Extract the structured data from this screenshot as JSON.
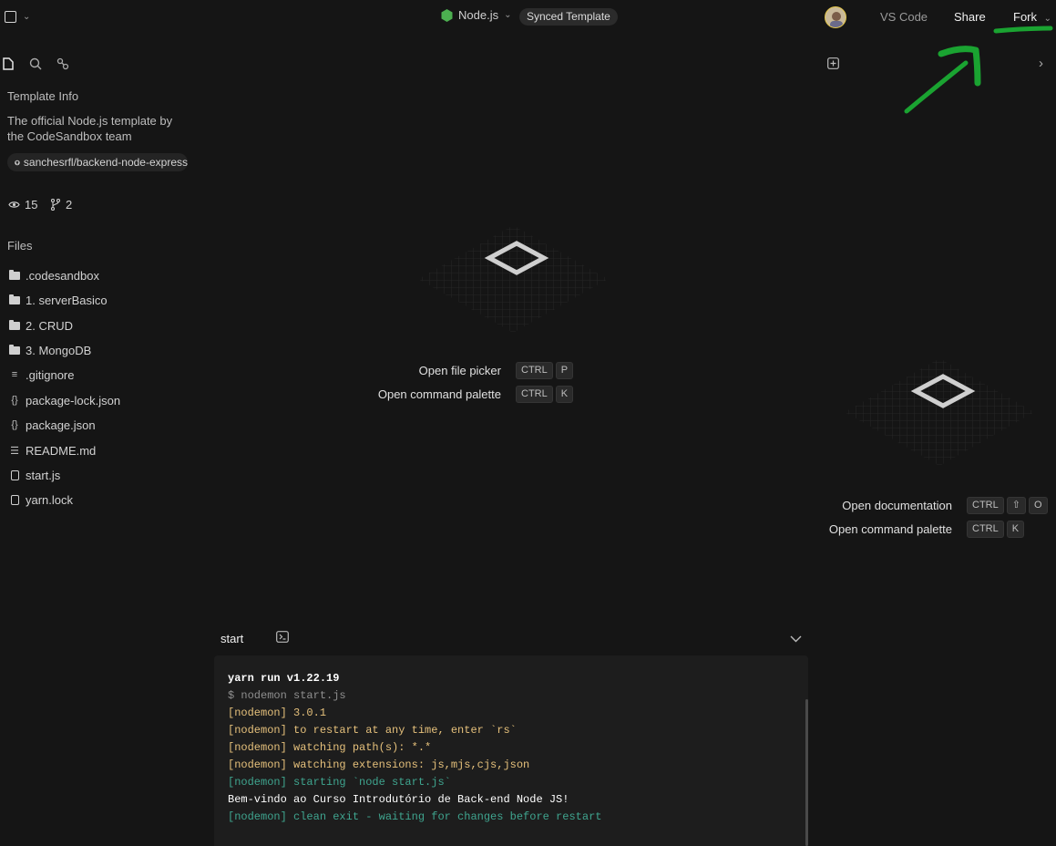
{
  "topbar": {
    "template_name": "Node.js",
    "template_badge": "Synced Template",
    "vscode_label": "VS Code",
    "share_label": "Share",
    "fork_label": "Fork"
  },
  "sidebar": {
    "section_title": "Template Info",
    "description": "The official Node.js template by the CodeSandbox team",
    "repo": "sanchesrfl/backend-node-express",
    "views": "15",
    "forks": "2",
    "files_title": "Files",
    "files": [
      {
        "name": ".codesandbox",
        "icon": "folder-icon"
      },
      {
        "name": "1. serverBasico",
        "icon": "folder-icon"
      },
      {
        "name": "2. CRUD",
        "icon": "folder-icon"
      },
      {
        "name": "3. MongoDB",
        "icon": "folder-icon"
      },
      {
        "name": ".gitignore",
        "icon": "lines-icon"
      },
      {
        "name": "package-lock.json",
        "icon": "braces-icon"
      },
      {
        "name": "package.json",
        "icon": "braces-icon"
      },
      {
        "name": "README.md",
        "icon": "markdown-icon"
      },
      {
        "name": "start.js",
        "icon": "file-icon"
      },
      {
        "name": "yarn.lock",
        "icon": "file-icon"
      }
    ]
  },
  "editor": {
    "shortcuts": [
      {
        "label": "Open file picker",
        "keys": [
          "CTRL",
          "P"
        ]
      },
      {
        "label": "Open command palette",
        "keys": [
          "CTRL",
          "K"
        ]
      }
    ]
  },
  "preview": {
    "shortcuts": [
      {
        "label": "Open documentation",
        "keys": [
          "CTRL",
          "⇧",
          "O"
        ]
      },
      {
        "label": "Open command palette",
        "keys": [
          "CTRL",
          "K"
        ]
      }
    ]
  },
  "terminal": {
    "tab_label": "start",
    "lines": [
      {
        "text": "yarn run v1.22.19",
        "color": "#ffffff",
        "bold": true
      },
      {
        "text": "$ nodemon start.js",
        "color": "#8f8f8f"
      },
      {
        "text": "[nodemon] 3.0.1",
        "color": "#e5c07b"
      },
      {
        "text": "[nodemon] to restart at any time, enter `rs`",
        "color": "#e5c07b"
      },
      {
        "text": "[nodemon] watching path(s): *.*",
        "color": "#e5c07b"
      },
      {
        "text": "[nodemon] watching extensions: js,mjs,cjs,json",
        "color": "#e5c07b"
      },
      {
        "text": "[nodemon] starting `node start.js`",
        "color": "#3fa58f"
      },
      {
        "text": "Bem-vindo ao Curso Introdutório de Back-end Node JS!",
        "color": "#ffffff"
      },
      {
        "text": "[nodemon] clean exit - waiting for changes before restart",
        "color": "#3fa58f"
      }
    ]
  },
  "colors": {
    "accent_green": "#1fa33c",
    "node_green": "#4caf50",
    "annotation_green": "#1aa331"
  }
}
